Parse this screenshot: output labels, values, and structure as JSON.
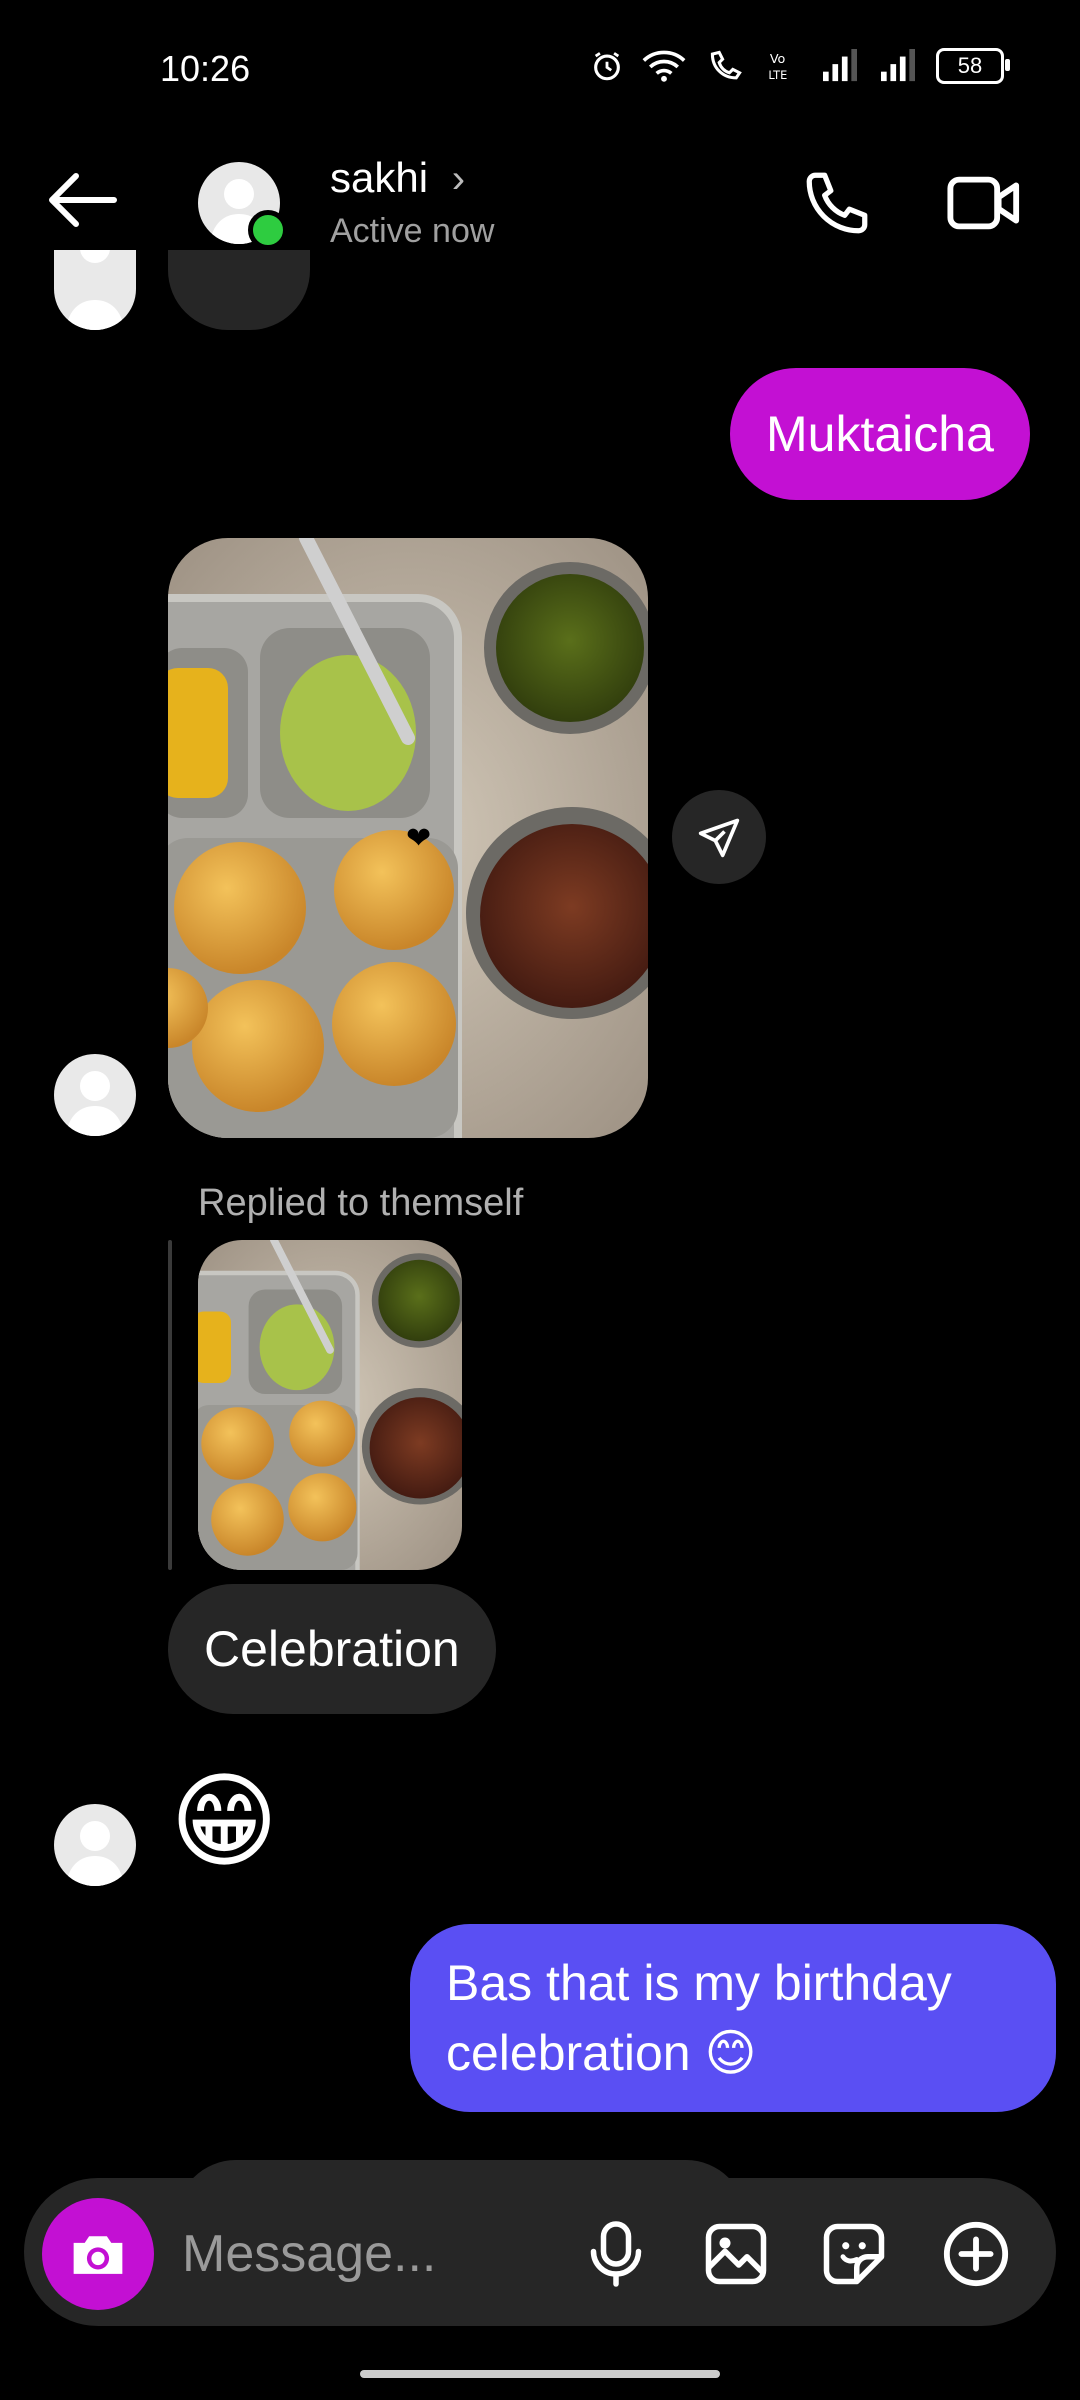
{
  "status_bar": {
    "time": "10:26",
    "battery": "58"
  },
  "header": {
    "name": "sakhi",
    "chevron": "›",
    "status": "Active now"
  },
  "messages": {
    "sent_1": "Muktaicha",
    "replied_label": "Replied to themself",
    "received_celebration": "Celebration",
    "received_emoji": "😁",
    "sent_2": "Bas that is my birthday celebration 😊"
  },
  "composer": {
    "placeholder": "Message..."
  },
  "colors": {
    "sent_pink": "#c310d3",
    "sent_blue": "#5a4ff3",
    "received": "#262626",
    "online": "#2ecc40"
  }
}
